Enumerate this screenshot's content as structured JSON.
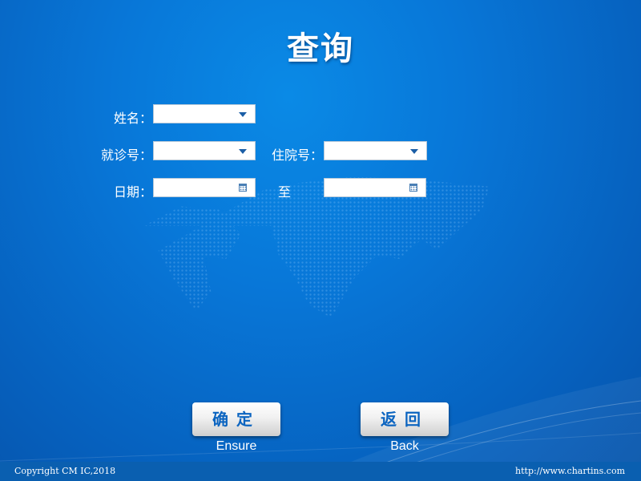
{
  "title": "查询",
  "form": {
    "name_label": "姓名：",
    "visit_no_label": "就诊号：",
    "inpatient_no_label": "住院号：",
    "date_label": "日期：",
    "to_label": "至",
    "name_value": "",
    "visit_no_value": "",
    "inpatient_no_value": "",
    "date_from_value": "",
    "date_to_value": ""
  },
  "buttons": {
    "ensure_label": "确定",
    "ensure_sub": "Ensure",
    "back_label": "返回",
    "back_sub": "Back"
  },
  "footer": {
    "copyright": "Copyright CM IC,2018",
    "url": "http://www.chartins.com"
  },
  "icons": {
    "dropdown": "chevron-down-icon",
    "calendar": "calendar-icon"
  },
  "colors": {
    "background": "#0877d8",
    "button_text": "#0b64c0",
    "footer": "#0a5fb0"
  }
}
